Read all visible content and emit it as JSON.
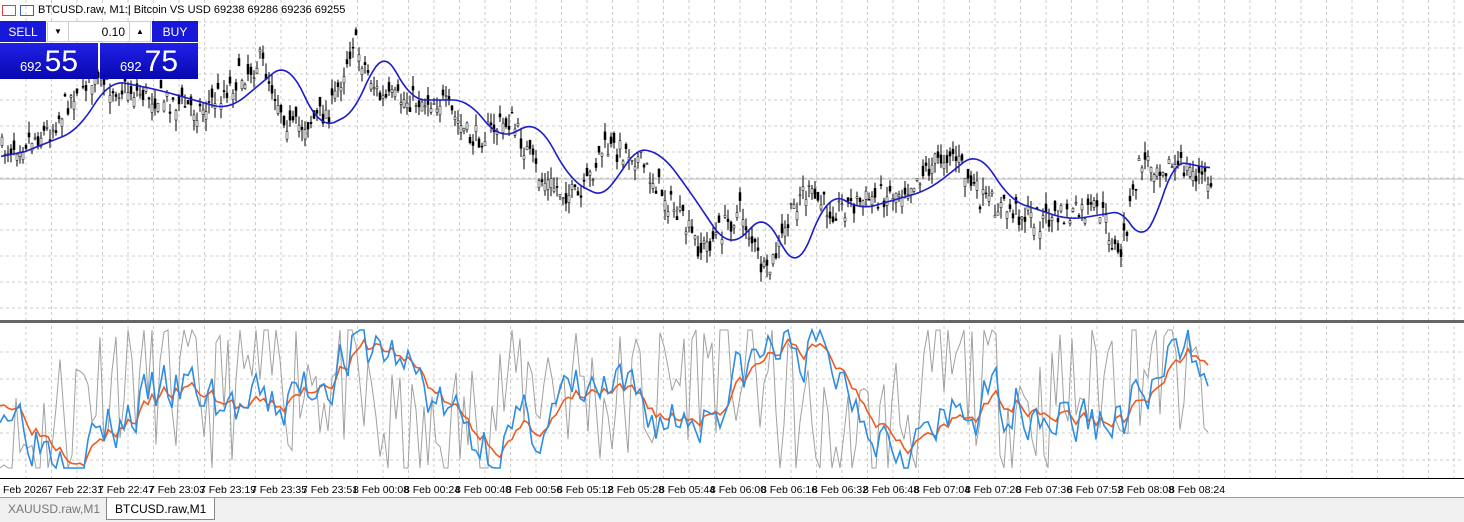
{
  "header": {
    "title": "BTCUSD.raw, M1:| Bitcoin VS USD  69238 69286 69236 69255"
  },
  "trade_panel": {
    "sell_label": "SELL",
    "buy_label": "BUY",
    "lot": "0.10",
    "sell_price_small": "692",
    "sell_price_big": "55",
    "buy_price_small": "692",
    "buy_price_big": "75"
  },
  "time_axis": [
    "Feb 2026",
    "7 Feb 22:31",
    "7 Feb 22:47",
    "7 Feb 23:03",
    "7 Feb 23:19",
    "7 Feb 23:35",
    "7 Feb 23:51",
    "8 Feb 00:08",
    "8 Feb 00:24",
    "8 Feb 00:40",
    "8 Feb 00:56",
    "8 Feb 05:12",
    "8 Feb 05:28",
    "8 Feb 05:44",
    "8 Feb 06:00",
    "8 Feb 06:16",
    "8 Feb 06:32",
    "8 Feb 06:48",
    "8 Feb 07:04",
    "8 Feb 07:20",
    "8 Feb 07:36",
    "8 Feb 07:52",
    "8 Feb 08:08",
    "8 Feb 08:24"
  ],
  "tabs": [
    {
      "label": "XAUUSD.raw,M1"
    },
    {
      "label": "BTCUSD.raw,M1"
    }
  ],
  "colors": {
    "ma": "#1c1ccc",
    "osc_fast": "#2e8de0",
    "osc_slow": "#f05a1e",
    "osc_raw": "#a0a0a0",
    "panel": "#1818d8"
  }
}
